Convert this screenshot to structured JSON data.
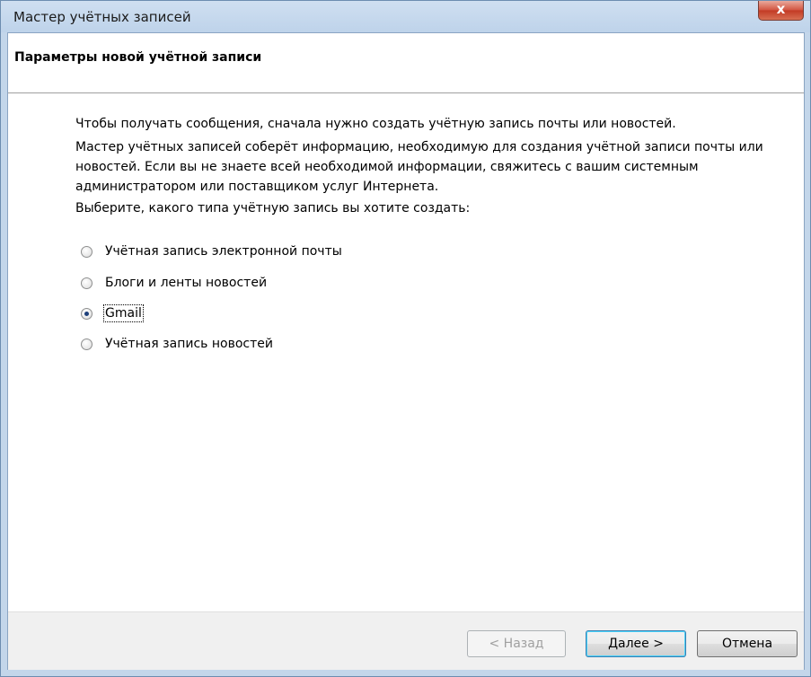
{
  "window": {
    "title": "Мастер учётных записей",
    "close_label": "x"
  },
  "header": {
    "title": "Параметры новой учётной записи"
  },
  "content": {
    "intro": "Чтобы получать сообщения, сначала нужно создать учётную запись почты или новостей.",
    "description": "Мастер учётных записей соберёт информацию, необходимую для создания учётной записи почты или новостей. Если вы не знаете всей необходимой информации, свяжитесь с вашим системным администратором или поставщиком услуг Интернета.",
    "prompt": "Выберите, какого типа учётную запись вы хотите создать:",
    "options": [
      {
        "label": "Учётная запись электронной почты",
        "selected": false
      },
      {
        "label": "Блоги и ленты новостей",
        "selected": false
      },
      {
        "label": "Gmail",
        "selected": true
      },
      {
        "label": "Учётная запись новостей",
        "selected": false
      }
    ]
  },
  "footer": {
    "back_label": "< Назад",
    "next_label": "Далее >",
    "cancel_label": "Отмена"
  }
}
